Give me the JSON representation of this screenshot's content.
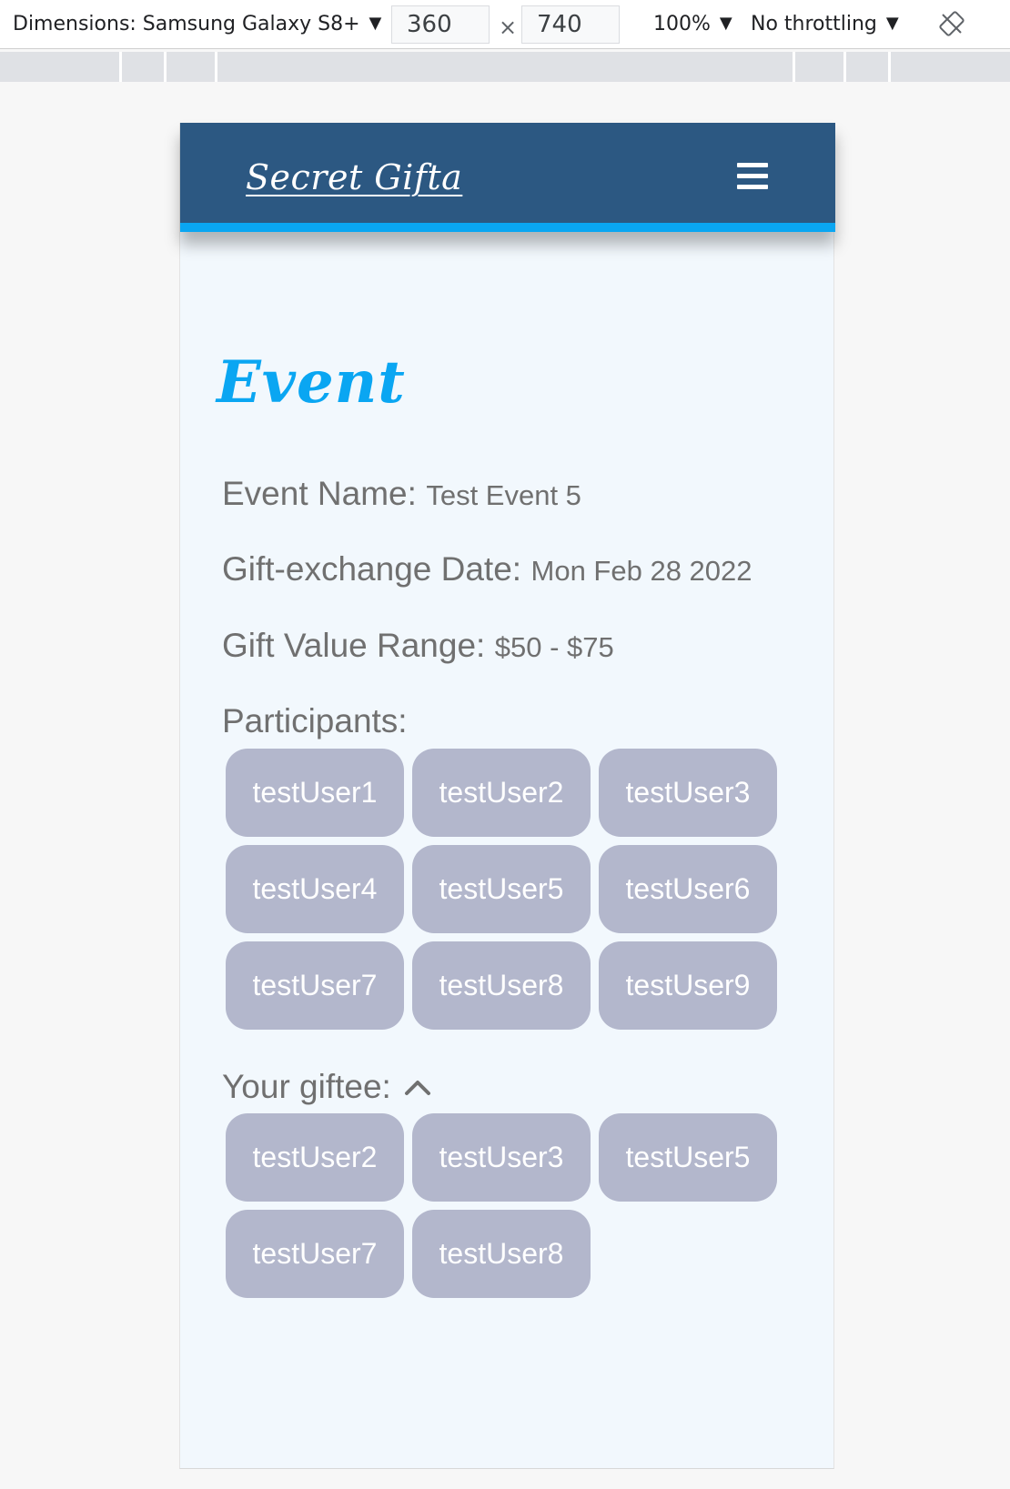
{
  "devtools": {
    "device_label": "Dimensions: Samsung Galaxy S8+",
    "width": "360",
    "height": "740",
    "times": "×",
    "zoom": "100%",
    "throttling": "No throttling"
  },
  "navbar": {
    "brand": "Secret Gifta",
    "menu_icon": "hamburger-menu-icon"
  },
  "page": {
    "title": "Event"
  },
  "event": {
    "name_label": "Event Name:",
    "name_value": "Test Event 5",
    "date_label": "Gift-exchange Date:",
    "date_value": "Mon Feb 28 2022",
    "range_label": "Gift Value Range:",
    "range_value": "$50 - $75"
  },
  "participants": {
    "label": "Participants:",
    "items": [
      "testUser1",
      "testUser2",
      "testUser3",
      "testUser4",
      "testUser5",
      "testUser6",
      "testUser7",
      "testUser8",
      "testUser9"
    ]
  },
  "giftee": {
    "label": "Your giftee:",
    "toggle_icon": "chevron-up-icon",
    "items": [
      "testUser2",
      "testUser3",
      "testUser5",
      "testUser7",
      "testUser8"
    ]
  },
  "colors": {
    "navbar": "#2c5882",
    "accent": "#0aa6f2",
    "chip": "#b3b7cc",
    "page_bg": "#f2f8fd"
  }
}
